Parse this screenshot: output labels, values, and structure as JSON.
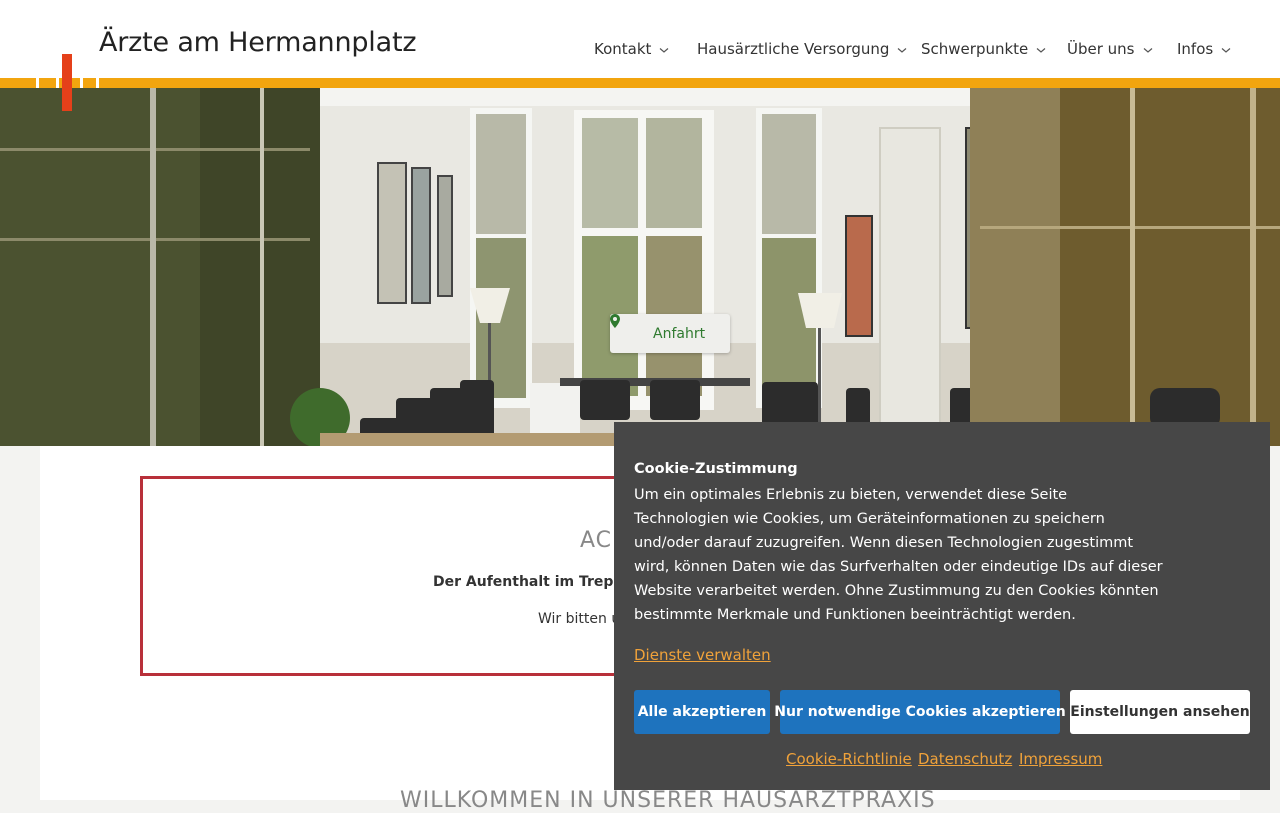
{
  "site": {
    "title": "Ärzte am Hermannplatz"
  },
  "nav": {
    "items": [
      {
        "label": "Kontakt"
      },
      {
        "label": "Hausärztliche Versorgung"
      },
      {
        "label": "Schwerpunkte"
      },
      {
        "label": "Über uns"
      },
      {
        "label": "Infos"
      }
    ]
  },
  "hero": {
    "anfahrt_label": "Anfahrt",
    "anfahrt_icon": "map-marker-icon"
  },
  "notice": {
    "title": "ACI",
    "text_bold": "Der Aufenthalt im Treppe",
    "text": "Wir bitten u"
  },
  "welcome": {
    "heading": "WILLKOMMEN IN UNSERER HAUSARZTPRAXIS"
  },
  "cookie": {
    "title": "Cookie-Zustimmung",
    "body": "Um ein optimales Erlebnis zu bieten, verwendet diese Seite Technologien wie Cookies, um Geräteinformationen zu speichern und/oder darauf zuzugreifen. Wenn diesen Technologien zugestimmt wird, können Daten wie das Surfverhalten oder eindeutige IDs auf dieser Website verarbeitet werden. Ohne Zustimmung zu den Cookies könnten bestimmte Merkmale und Funktionen beeinträchtigt werden.",
    "manage_link": "Dienste verwalten",
    "buttons": {
      "accept_all": "Alle akzeptieren",
      "necessary_only": "Nur notwendige Cookies akzeptieren",
      "view_settings": "Einstellungen ansehen"
    },
    "links": {
      "cookie_policy": "Cookie-Richtlinie",
      "privacy": "Datenschutz",
      "imprint": "Impressum"
    }
  },
  "colors": {
    "accent_orange": "#f2a50f",
    "logo_red": "#e5401a",
    "button_blue": "#1e73be",
    "cookie_bg": "#474747",
    "link_orange": "#f0a23a",
    "notice_border": "#b8303a"
  }
}
